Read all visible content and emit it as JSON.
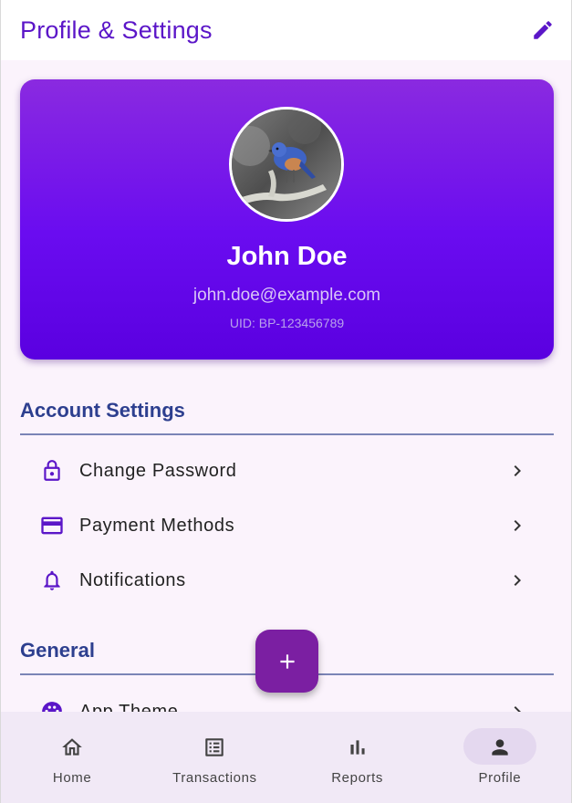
{
  "appbar": {
    "title": "Profile & Settings",
    "edit_icon": "edit-pencil-icon"
  },
  "profile": {
    "name": "John Doe",
    "email": "john.doe@example.com",
    "uid": "UID: BP-123456789",
    "avatar": "bluebird-photo"
  },
  "sections": [
    {
      "title": "Account Settings",
      "items": [
        {
          "label": "Change Password",
          "icon": "lock-icon"
        },
        {
          "label": "Payment Methods",
          "icon": "credit-card-icon"
        },
        {
          "label": "Notifications",
          "icon": "bell-icon"
        }
      ]
    },
    {
      "title": "General",
      "items": [
        {
          "label": "App Theme",
          "icon": "palette-icon"
        }
      ]
    }
  ],
  "fab": {
    "icon": "plus-icon"
  },
  "bottom_nav": {
    "items": [
      {
        "label": "Home",
        "icon": "home-icon",
        "active": false
      },
      {
        "label": "Transactions",
        "icon": "list-icon",
        "active": false
      },
      {
        "label": "Reports",
        "icon": "bar-chart-icon",
        "active": false
      },
      {
        "label": "Profile",
        "icon": "person-icon",
        "active": true
      }
    ]
  },
  "colors": {
    "accent": "#5b16c8",
    "card_gradient_top": "#8a2ae0",
    "card_gradient_bottom": "#5a00e0",
    "section_title": "#2d3f8f",
    "fab": "#7b1fa2"
  }
}
